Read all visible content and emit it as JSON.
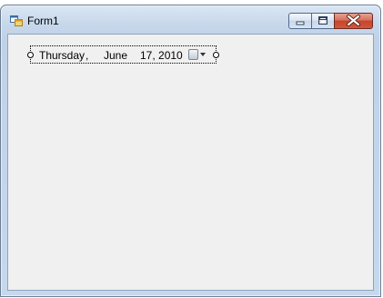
{
  "window": {
    "title": "Form1",
    "icon": "form-app-icon",
    "caption_icons": [
      "minimize-icon",
      "maximize-icon",
      "close-icon"
    ]
  },
  "date_picker": {
    "day_of_week": "Thursday",
    "separator": ",",
    "month": "June",
    "date_year": "17, 2010",
    "dropdown_icon": "calendar-dropdown-icon"
  },
  "colors": {
    "client_background": "#f0f0f0",
    "close_button": "#c5442c",
    "frame": "#bfd2e8"
  }
}
